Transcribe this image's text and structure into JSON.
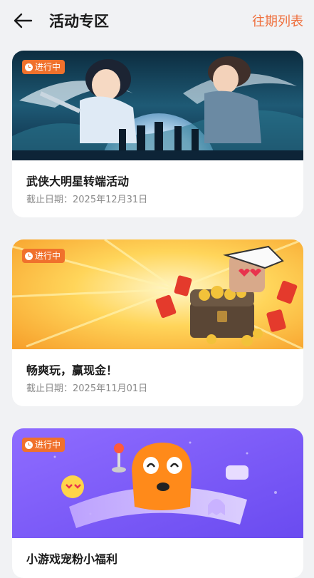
{
  "header": {
    "back_icon": "arrow-left-icon",
    "title": "活动专区",
    "history_label": "往期列表"
  },
  "colors": {
    "accent": "#ef6f3c",
    "badge": "#f0712c",
    "background": "#f1f2f4"
  },
  "activities": [
    {
      "status": "进行中",
      "title": "武侠大明星转端活动",
      "deadline": "截止日期：2025年12月31日",
      "banner_theme": "wuxia-night-moon"
    },
    {
      "status": "进行中",
      "title": "畅爽玩，赢现金！",
      "deadline": "截止日期：2025年11月01日",
      "banner_theme": "gold-treasure-chest"
    },
    {
      "status": "进行中",
      "title": "小游戏宠粉小福利",
      "deadline": "",
      "banner_theme": "purple-mascot"
    }
  ]
}
